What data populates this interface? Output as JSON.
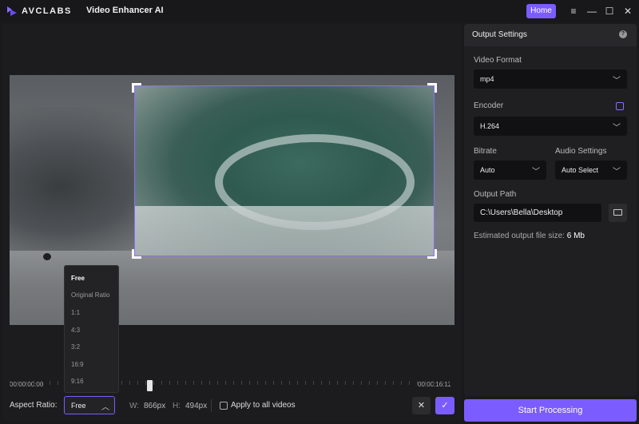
{
  "app": {
    "brand": "AVCLABS",
    "name": "Video Enhancer AI",
    "home_label": "Home",
    "accent_color": "#7b5cff"
  },
  "window_controls": {
    "menu": "≡",
    "minimize": "—",
    "maximize": "☐",
    "close": "✕"
  },
  "timeline": {
    "start_time": "00:00:00:00",
    "end_time": "00:00:16:11"
  },
  "crop": {
    "aspect_ratio_label": "Aspect Ratio:",
    "aspect_ratio_value": "Free",
    "options": [
      "Free",
      "Original Ratio",
      "1:1",
      "4:3",
      "3:2",
      "16:9",
      "9:16"
    ],
    "width_label": "W:",
    "width_value": "866px",
    "height_label": "H:",
    "height_value": "494px",
    "apply_all_label": "Apply to all videos"
  },
  "output_settings": {
    "title": "Output Settings",
    "video_format_label": "Video Format",
    "video_format_value": "mp4",
    "encoder_label": "Encoder",
    "encoder_value": "H.264",
    "bitrate_label": "Bitrate",
    "bitrate_value": "Auto",
    "audio_label": "Audio Settings",
    "audio_value": "Auto Select",
    "output_path_label": "Output Path",
    "output_path_value": "C:\\Users\\Bella\\Desktop",
    "estimated_label": "Estimated output file size:",
    "estimated_value": "6 Mb"
  },
  "actions": {
    "start_processing": "Start Processing"
  }
}
